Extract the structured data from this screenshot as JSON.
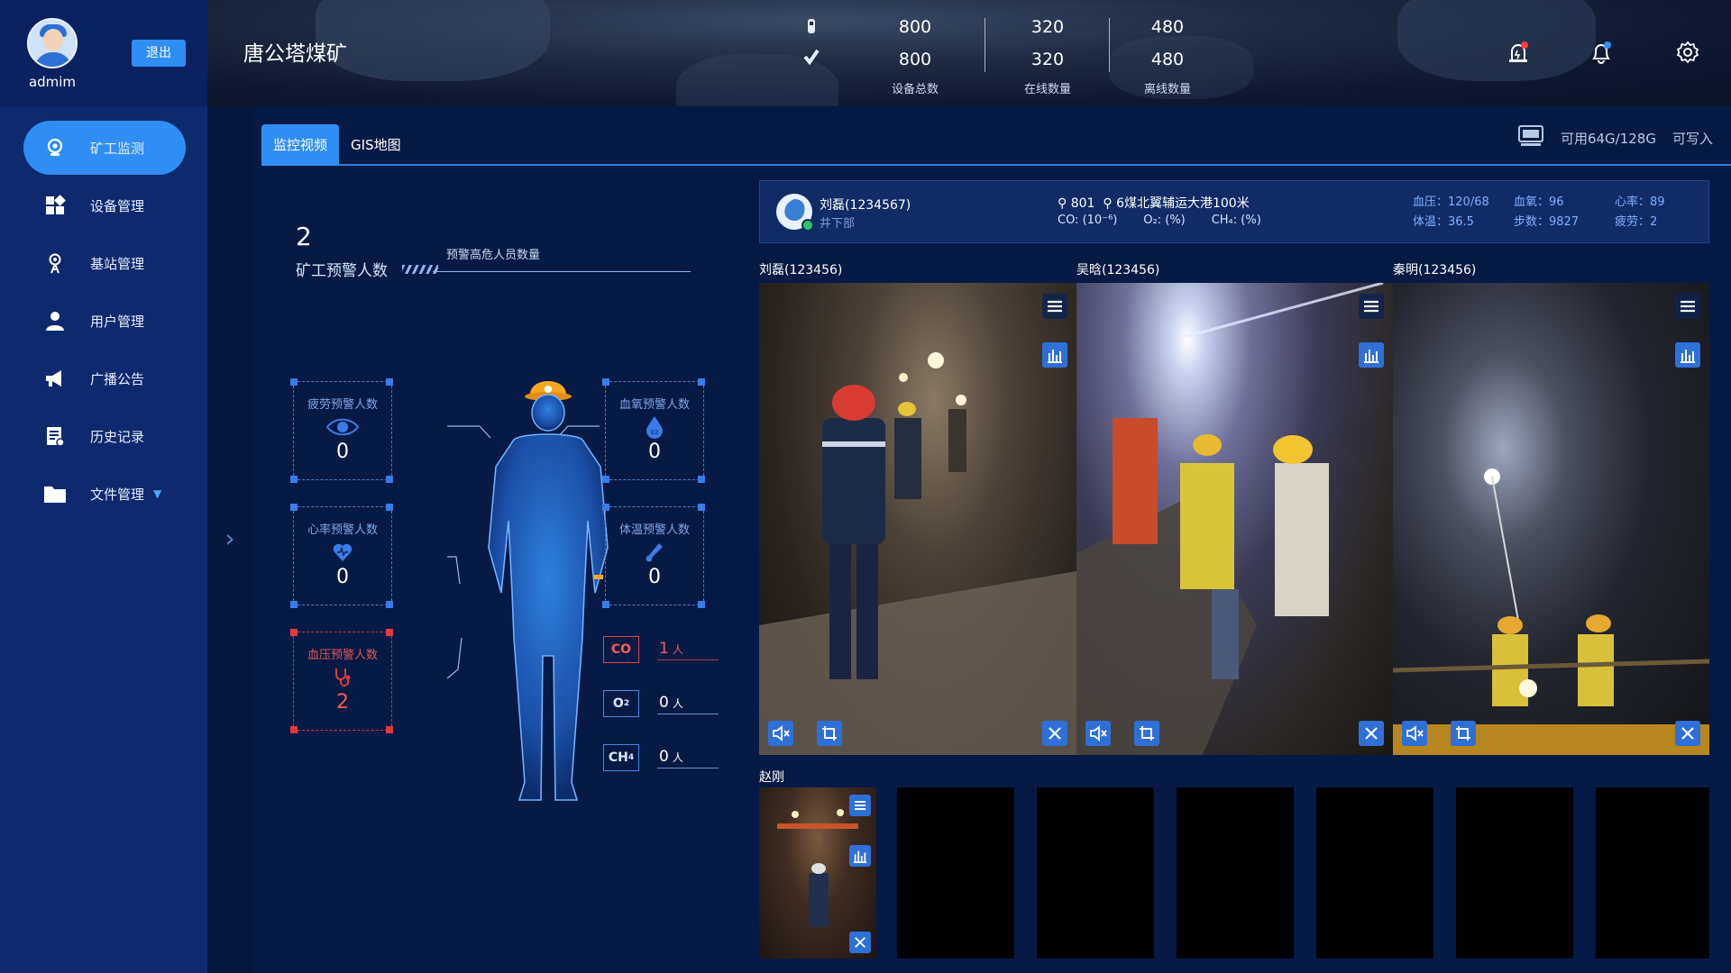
{
  "user": {
    "name": "admim",
    "logout_label": "退出"
  },
  "menu": [
    {
      "label": "矿工监测",
      "icon": "camera-icon",
      "active": true
    },
    {
      "label": "设备管理",
      "icon": "grid-icon"
    },
    {
      "label": "基站管理",
      "icon": "antenna-icon"
    },
    {
      "label": "用户管理",
      "icon": "user-icon"
    },
    {
      "label": "广播公告",
      "icon": "megaphone-icon"
    },
    {
      "label": "历史记录",
      "icon": "document-icon"
    },
    {
      "label": "文件管理",
      "icon": "folder-icon",
      "has_caret": true
    }
  ],
  "header": {
    "title": "唐公塔煤矿",
    "stats": [
      {
        "top": "800",
        "bottom": "800",
        "label": "设备总数"
      },
      {
        "top": "320",
        "bottom": "320",
        "label": "在线数量"
      },
      {
        "top": "480",
        "bottom": "480",
        "label": "离线数量"
      }
    ],
    "icons": [
      "alarm-icon",
      "bell-icon",
      "gear-icon"
    ]
  },
  "tabs": [
    {
      "label": "监控视频",
      "active": true
    },
    {
      "label": "GIS地图"
    }
  ],
  "storage": {
    "available": "可用64G/128G",
    "status": "可写入"
  },
  "warning": {
    "count": "2",
    "label": "矿工预警人数",
    "sub_label": "预警高危人员数量",
    "boxes": [
      {
        "title": "疲劳预警人数",
        "value": "0",
        "icon": "eye-icon"
      },
      {
        "title": "血氧预警人数",
        "value": "0",
        "icon": "o2-drop-icon"
      },
      {
        "title": "心率预警人数",
        "value": "0",
        "icon": "heart-icon"
      },
      {
        "title": "体温预警人数",
        "value": "0",
        "icon": "thermometer-icon"
      },
      {
        "title": "血压预警人数",
        "value": "2",
        "icon": "stethoscope-icon",
        "alert": true
      }
    ],
    "gases": [
      {
        "tag": "CO",
        "value": "1",
        "unit": "人",
        "alert": true
      },
      {
        "tag": "O2",
        "value": "0",
        "unit": "人"
      },
      {
        "tag": "CH4",
        "value": "0",
        "unit": "人"
      }
    ]
  },
  "info": {
    "name": "刘磊(1234567)",
    "dept": "井下部",
    "station": "801",
    "location": "6煤北翼辅运大港100米",
    "co": "CO: (10⁻⁶)",
    "o2": "O₂: (%)",
    "ch4": "CH₄: (%)",
    "vitals": [
      [
        "血压：120/68",
        "血氧：96",
        "心率：89"
      ],
      [
        "体温：36.5",
        "步数：9827",
        "疲劳：2"
      ]
    ]
  },
  "cameras": [
    {
      "label": "刘磊(123456)"
    },
    {
      "label": "吴晗(123456)"
    },
    {
      "label": "秦明(123456)"
    }
  ],
  "thumbs": {
    "label": "赵刚"
  },
  "colors": {
    "accent": "#2f8ef3",
    "alert": "#e03b3b",
    "bg": "#061a45",
    "sidebar": "#0e2a6e"
  }
}
